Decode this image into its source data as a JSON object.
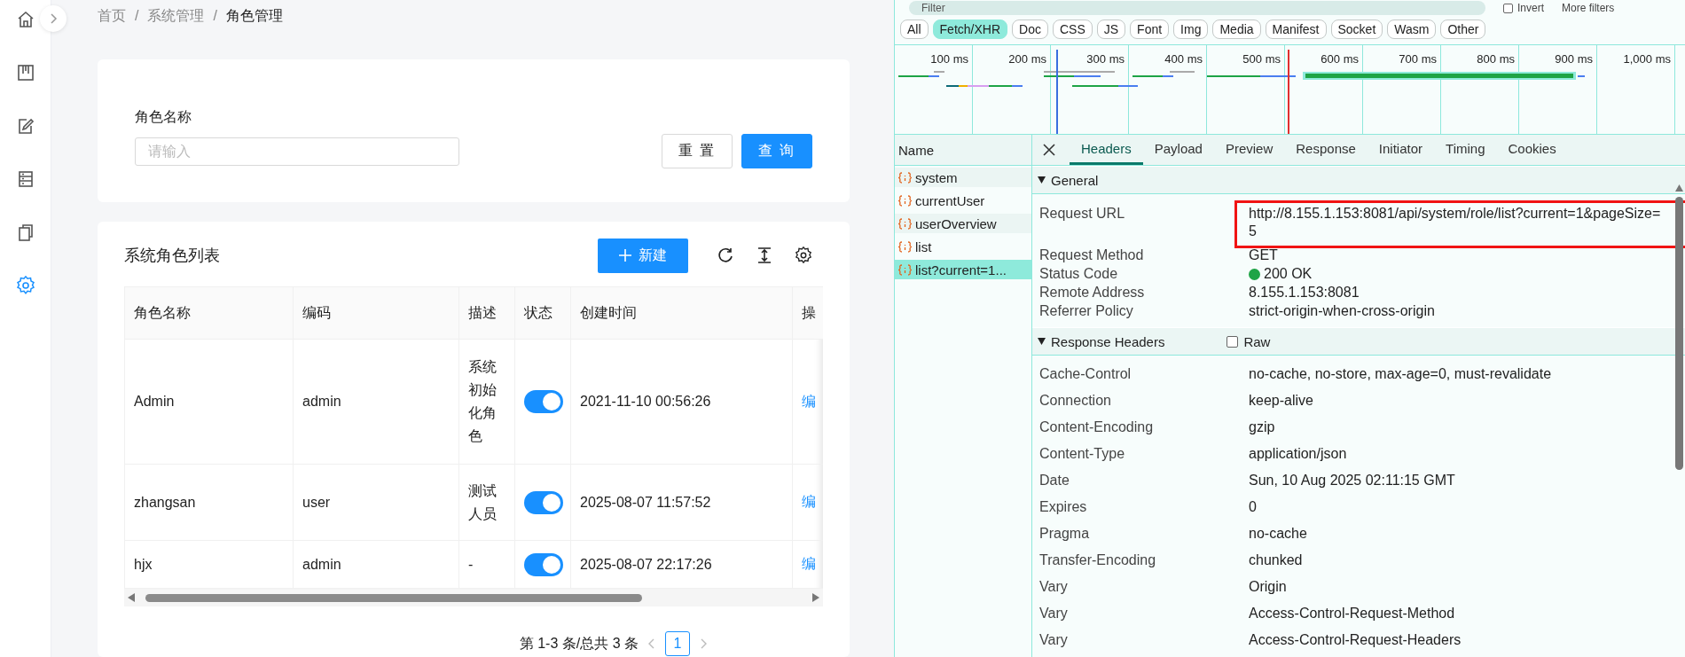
{
  "sidebar": {
    "items": [
      {
        "selected": false
      },
      {
        "selected": false
      },
      {
        "selected": false
      },
      {
        "selected": false
      },
      {
        "selected": false
      },
      {
        "selected": true
      }
    ]
  },
  "breadcrumb": {
    "separator": "/",
    "items": [
      "首页",
      "系统管理",
      "角色管理"
    ]
  },
  "query_form": {
    "label": "角色名称",
    "placeholder": "请输入",
    "buttons": [
      {
        "label": "重 置",
        "kind": "default"
      },
      {
        "label": "查 询",
        "kind": "primary"
      }
    ]
  },
  "table_card": {
    "title": "系统角色列表",
    "new_button": "新建"
  },
  "table": {
    "columns": [
      "角色名称",
      "编码",
      "描述",
      "状态",
      "创建时间",
      "操"
    ],
    "rows": [
      {
        "name": "Admin",
        "code": "admin",
        "description": "系统初始化角色",
        "enabled": true,
        "created": "2021-11-10 00:56:26",
        "action": "编"
      },
      {
        "name": "zhangsan",
        "code": "user",
        "description": "测试人员",
        "enabled": true,
        "created": "2025-08-07 11:57:52",
        "action": "编"
      },
      {
        "name": "hjx",
        "code": "admin",
        "description": "-",
        "enabled": true,
        "created": "2025-08-07 22:17:26",
        "action": "编"
      }
    ]
  },
  "pagination": {
    "summary": "第 1-3 条/总共 3 条",
    "pages": [
      {
        "label": "1",
        "selected": true
      }
    ]
  },
  "devtools": {
    "filter": {
      "placeholder": "Filter",
      "invert_label": "Invert",
      "invert_checked": false,
      "more_filters": "More filters"
    },
    "type_filters": [
      {
        "label": "All",
        "selected": false
      },
      {
        "label": "Fetch/XHR",
        "selected": true
      },
      {
        "label": "Doc",
        "selected": false
      },
      {
        "label": "CSS",
        "selected": false
      },
      {
        "label": "JS",
        "selected": false
      },
      {
        "label": "Font",
        "selected": false
      },
      {
        "label": "Img",
        "selected": false
      },
      {
        "label": "Media",
        "selected": false
      },
      {
        "label": "Manifest",
        "selected": false
      },
      {
        "label": "Socket",
        "selected": false
      },
      {
        "label": "Wasm",
        "selected": false
      },
      {
        "label": "Other",
        "selected": false
      }
    ],
    "timeline_ticks": [
      "100 ms",
      "200 ms",
      "300 ms",
      "400 ms",
      "500 ms",
      "600 ms",
      "700 ms",
      "800 ms",
      "900 ms",
      "1,000 ms"
    ],
    "requests_header": "Name",
    "requests": [
      {
        "name": "system",
        "selected": false
      },
      {
        "name": "currentUser",
        "selected": false
      },
      {
        "name": "userOverview",
        "selected": false
      },
      {
        "name": "list",
        "selected": false
      },
      {
        "name": "list?current=1...",
        "selected": true
      }
    ],
    "tabs": [
      {
        "label": "Headers",
        "selected": true
      },
      {
        "label": "Payload",
        "selected": false
      },
      {
        "label": "Preview",
        "selected": false
      },
      {
        "label": "Response",
        "selected": false
      },
      {
        "label": "Initiator",
        "selected": false
      },
      {
        "label": "Timing",
        "selected": false
      },
      {
        "label": "Cookies",
        "selected": false
      }
    ],
    "general": {
      "title": "General",
      "expanded": true,
      "rows": [
        {
          "key": "Request URL",
          "value": "http://8.155.1.153:8081/api/system/role/list?current=1&pageSize=5",
          "highlighted": true
        },
        {
          "key": "Request Method",
          "value": "GET",
          "highlighted": false
        },
        {
          "key": "Status Code",
          "value": "200 OK",
          "color": "#1ea446",
          "highlighted": false
        },
        {
          "key": "Remote Address",
          "value": "8.155.1.153:8081",
          "highlighted": false
        },
        {
          "key": "Referrer Policy",
          "value": "strict-origin-when-cross-origin",
          "highlighted": false
        }
      ]
    },
    "response_headers": {
      "title": "Response Headers",
      "expanded": true,
      "raw_label": "Raw",
      "raw_checked": false,
      "rows": [
        {
          "key": "Cache-Control",
          "value": "no-cache, no-store, max-age=0, must-revalidate"
        },
        {
          "key": "Connection",
          "value": "keep-alive"
        },
        {
          "key": "Content-Encoding",
          "value": "gzip"
        },
        {
          "key": "Content-Type",
          "value": "application/json"
        },
        {
          "key": "Date",
          "value": "Sun, 10 Aug 2025 02:11:15 GMT"
        },
        {
          "key": "Expires",
          "value": "0"
        },
        {
          "key": "Pragma",
          "value": "no-cache"
        },
        {
          "key": "Transfer-Encoding",
          "value": "chunked"
        },
        {
          "key": "Vary",
          "value": "Origin"
        },
        {
          "key": "Vary",
          "value": "Access-Control-Request-Method"
        },
        {
          "key": "Vary",
          "value": "Access-Control-Request-Headers"
        }
      ]
    }
  }
}
